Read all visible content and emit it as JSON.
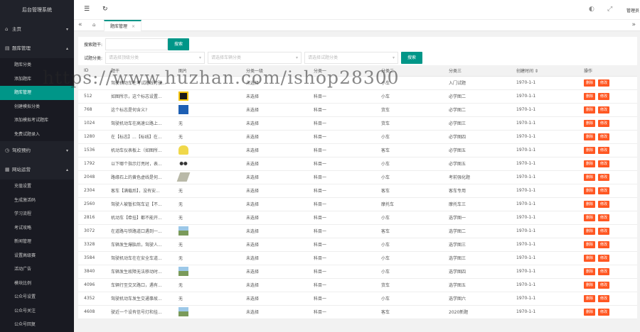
{
  "app": {
    "title": "后台管理系统"
  },
  "sidebar": {
    "home": "主页",
    "group1": "题库管理",
    "group1_items": [
      "题库分类",
      "添加题库",
      "题库管理",
      "创建模拟分类",
      "添加模拟考试题库",
      "免费试题录入"
    ],
    "group2": "驾校预约",
    "group3": "网站运营",
    "group3_items": [
      "充值设置",
      "生成激活码",
      "学习流程",
      "考试攻略",
      "新闻管理",
      "设置高级赛",
      "活动广告",
      "模块比例",
      "公众号设置",
      "公众号关注",
      "公众号回复"
    ]
  },
  "topbar": {
    "user": "管理员"
  },
  "tabs": [
    {
      "label": "题库管理"
    }
  ],
  "search": {
    "label": "搜索题干:",
    "btn": "搜索",
    "cat_label": "试题分类:",
    "sel1": "请选择顶级分类",
    "sel2": "请选择车辆分类",
    "sel3": "请选择试题分类",
    "btn2": "搜索"
  },
  "watermark": "https://www.huzhan.com/ishop28300",
  "table": {
    "headers": [
      "ID",
      "题干",
      "图片",
      "分类一级",
      "分类一",
      "分类二",
      "分类三",
      "创建时间 ⇕",
      "操作"
    ],
    "op_edit": "删除",
    "op_del": "修改",
    "rows": [
      [
        "",
        "驾驶机动车在考试路线行驶...",
        "",
        "未选择",
        "",
        "小车",
        "入门试题",
        "1970-1-1"
      ],
      [
        "512",
        "如图所示，这个标志设置...",
        "img-yellow",
        "未选择",
        "科目一",
        "小车",
        "必学图二",
        "1970-1-1"
      ],
      [
        "768",
        "这个标志是何含义?",
        "img-blue",
        "未选择",
        "科目一",
        "货车",
        "必学图二",
        "1970-1-1"
      ],
      [
        "1024",
        "驾驶机动车在高速公路上...",
        "无",
        "未选择",
        "科目一",
        "货车",
        "必学图三",
        "1970-1-1"
      ],
      [
        "1280",
        "在【标志】...【标线】在...",
        "无",
        "未选择",
        "科目一",
        "小车",
        "必学图四",
        "1970-1-1"
      ],
      [
        "1536",
        "机动车仪表板上（如图所...",
        "img-lamp",
        "未选择",
        "科目一",
        "客车",
        "必学图五",
        "1970-1-1"
      ],
      [
        "1792",
        "以下哪个指示灯亮时，表...",
        "img-dots",
        "未选择",
        "科目一",
        "小车",
        "必学图五",
        "1970-1-1"
      ],
      [
        "2048",
        "路缘石上的黄色虚线是何...",
        "img-grey",
        "未选择",
        "科目一",
        "小车",
        "考前强化题",
        "1970-1-1"
      ],
      [
        "2304",
        "客车【满载后】，没有安...",
        "无",
        "未选择",
        "科目一",
        "客车",
        "客车专用",
        "1970-1-1"
      ],
      [
        "2560",
        "驾驶人被暂扣驾车证【不...",
        "无",
        "未选择",
        "科目一",
        "摩托车",
        "摩托车三",
        "1970-1-1"
      ],
      [
        "2816",
        "机动车【牵挂】都不能开...",
        "无",
        "未选择",
        "科目一",
        "小车",
        "选学图一",
        "1970-1-1"
      ],
      [
        "3072",
        "在道路与铁路道口遇到一...",
        "img-photo",
        "未选择",
        "科目一",
        "客车",
        "选学图二",
        "1970-1-1"
      ],
      [
        "3328",
        "车辆发生爆胎后，驾驶人...",
        "无",
        "未选择",
        "科目一",
        "小车",
        "选学图三",
        "1970-1-1"
      ],
      [
        "3584",
        "驾驶机动车在在安全车道...",
        "无",
        "未选择",
        "科目一",
        "小车",
        "选学图三",
        "1970-1-1"
      ],
      [
        "3840",
        "车辆发生故障无法移动时...",
        "img-photo",
        "未选择",
        "科目一",
        "小车",
        "选学图四",
        "1970-1-1"
      ],
      [
        "4096",
        "车辆行至交叉路口，遇有...",
        "无",
        "未选择",
        "科目一",
        "货车",
        "选学图五",
        "1970-1-1"
      ],
      [
        "4352",
        "驾驶机动车发生交通事故...",
        "无",
        "未选择",
        "科目一",
        "小车",
        "选学图六",
        "1970-1-1"
      ],
      [
        "4608",
        "驶近一个设有信号灯和挂...",
        "img-photo",
        "未选择",
        "科目一",
        "客车",
        "2020新题",
        "1970-1-1"
      ]
    ]
  }
}
